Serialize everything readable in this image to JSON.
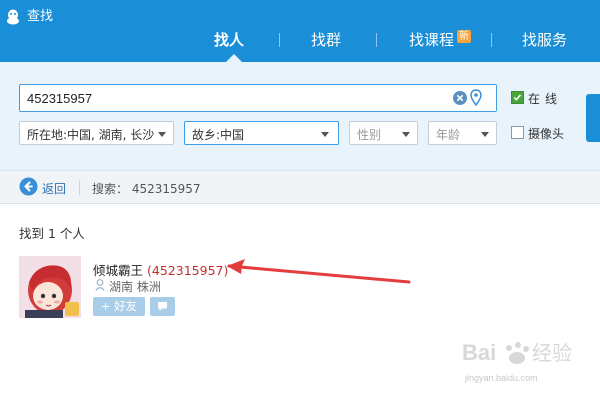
{
  "app": {
    "title": "查找",
    "logo_icon": "qq-penguin-icon"
  },
  "nav": {
    "tabs": [
      {
        "label": "找人",
        "active": true
      },
      {
        "label": "找群",
        "active": false
      },
      {
        "label": "找课程",
        "active": false,
        "badge": "新"
      },
      {
        "label": "找服务",
        "active": false
      }
    ]
  },
  "search": {
    "query": "452315957",
    "clear_icon": "clear-circle-icon",
    "location_icon": "location-pin-icon",
    "filters": {
      "location": "所在地:中国, 湖南, 长沙",
      "hometown": "故乡:中国",
      "gender_placeholder": "性别",
      "age_placeholder": "年龄"
    },
    "options": {
      "online_label": "在线",
      "online_checked": true,
      "camera_label": "摄像头",
      "camera_checked": false
    }
  },
  "breadcrumb": {
    "back_label": "返回",
    "summary": "搜索： 452315957"
  },
  "results": {
    "count_text": "找到 1 个人",
    "items": [
      {
        "nickname": "倾城霸王",
        "qq_number": "(452315957)",
        "location": "湖南  株洲",
        "add_friend_label": "+ 好友",
        "message_icon": "chat-bubble-icon"
      }
    ]
  },
  "watermark": {
    "url": "jingyan.baidu.com"
  },
  "colors": {
    "header": "#1b8ed8",
    "panel": "#e9f3fb",
    "accent_red": "#c4312d",
    "online_green": "#4aa63a"
  }
}
